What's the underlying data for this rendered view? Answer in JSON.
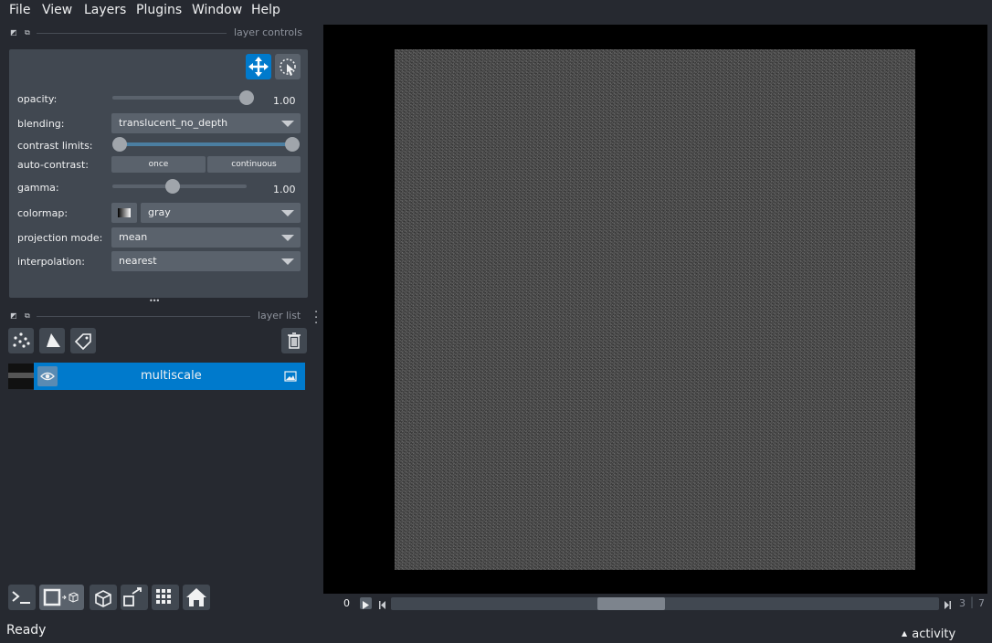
{
  "menu": [
    "File",
    "View",
    "Layers",
    "Plugins",
    "Window",
    "Help"
  ],
  "layer_controls": {
    "title": "layer controls",
    "opacity_label": "opacity:",
    "opacity_value": "1.00",
    "opacity_level": 1.0,
    "blending_label": "blending:",
    "blending_value": "translucent_no_depth",
    "contrast_label": "contrast limits:",
    "autocontrast_label": "auto-contrast:",
    "once_label": "once",
    "continuous_label": "continuous",
    "gamma_label": "gamma:",
    "gamma_value": "1.00",
    "gamma_level": 0.45,
    "colormap_label": "colormap:",
    "colormap_value": "gray",
    "projection_label": "projection mode:",
    "projection_value": "mean",
    "interpolation_label": "interpolation:",
    "interpolation_value": "nearest",
    "more_glyph": "•••"
  },
  "layer_list": {
    "title": "layer list",
    "layers": [
      {
        "name": "multiscale",
        "selected": true
      }
    ]
  },
  "dims": {
    "current": "0",
    "slice_a": "3",
    "slice_b": "7",
    "slider_position": 0.35
  },
  "status": {
    "text": "Ready",
    "activity": "activity",
    "activity_arrow": "▲"
  },
  "colors": {
    "accent": "#007acc",
    "panel": "#414851",
    "background": "#262930"
  },
  "icons": [
    "move-icon",
    "transform-icon",
    "points-icon",
    "shapes-icon",
    "labels-icon",
    "delete-icon",
    "eye-icon",
    "image-icon",
    "console-icon",
    "ndisplay-icon",
    "roll-icon",
    "transpose-icon",
    "grid-icon",
    "home-icon"
  ]
}
